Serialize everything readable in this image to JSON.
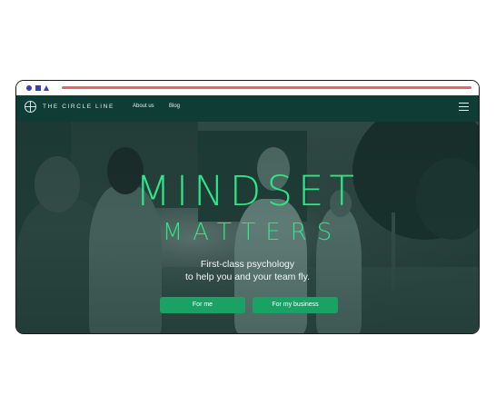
{
  "nav": {
    "brand": "THE CIRCLE LINE",
    "links": [
      "About us",
      "Blog"
    ]
  },
  "hero": {
    "headline_line1": "MINDSET",
    "headline_line2": "MATTERS",
    "subtitle_line1": "First-class psychology",
    "subtitle_line2": "to help you and your team fly.",
    "buttons": [
      "For me",
      "For my business"
    ]
  },
  "colors": {
    "accent_green": "#2ee58a",
    "button_green": "#1aa264",
    "nav_bg": "#0f3d36",
    "urlbar": "#e8636d",
    "chrome_icons": "#3a3fb0"
  },
  "icons": [
    "circle-logo-icon",
    "hamburger-menu-icon",
    "window-circle-icon",
    "window-square-icon",
    "window-triangle-icon"
  ]
}
